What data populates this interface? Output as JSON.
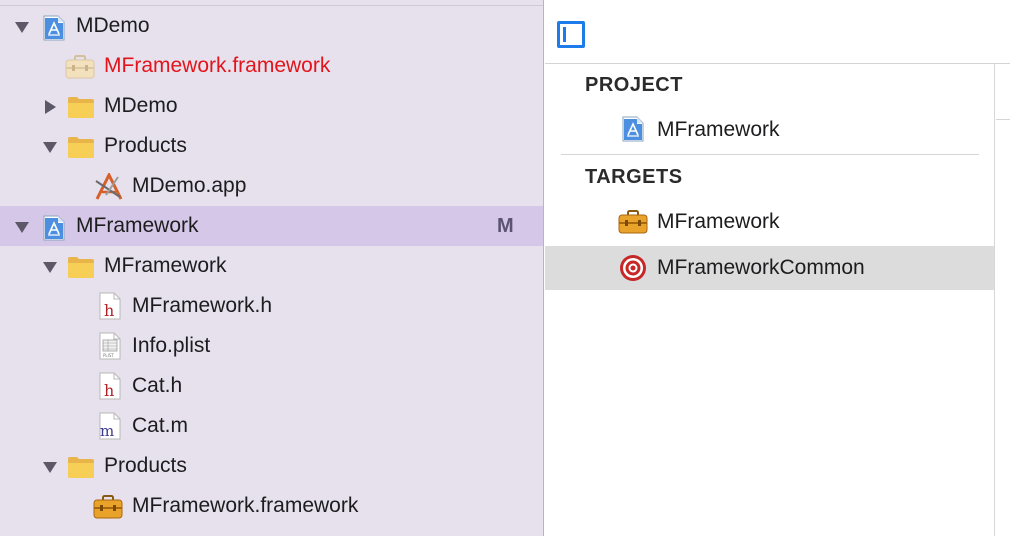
{
  "navigator": {
    "items": [
      {
        "label": "MDemo",
        "disclosure": "expanded",
        "icon": "xcode-project-icon"
      },
      {
        "label": "MFramework.framework",
        "disclosure": "none",
        "icon": "framework-missing-icon",
        "color": "#e3141b"
      },
      {
        "label": "MDemo",
        "disclosure": "collapsed",
        "icon": "folder-icon"
      },
      {
        "label": "Products",
        "disclosure": "expanded",
        "icon": "folder-icon"
      },
      {
        "label": "MDemo.app",
        "disclosure": "none",
        "icon": "app-icon"
      },
      {
        "label": "MFramework",
        "disclosure": "expanded",
        "icon": "xcode-project-icon",
        "badge": "M",
        "selected": true
      },
      {
        "label": "MFramework",
        "disclosure": "expanded",
        "icon": "folder-icon"
      },
      {
        "label": "MFramework.h",
        "disclosure": "none",
        "icon": "header-file-icon"
      },
      {
        "label": "Info.plist",
        "disclosure": "none",
        "icon": "plist-file-icon"
      },
      {
        "label": "Cat.h",
        "disclosure": "none",
        "icon": "header-file-icon"
      },
      {
        "label": "Cat.m",
        "disclosure": "none",
        "icon": "objc-file-icon"
      },
      {
        "label": "Products",
        "disclosure": "expanded",
        "icon": "folder-icon"
      },
      {
        "label": "MFramework.framework",
        "disclosure": "none",
        "icon": "framework-icon"
      }
    ]
  },
  "editor": {
    "sidebar_toggle_icon": "sidebar-toggle-icon",
    "project_header": "PROJECT",
    "project_item": "MFramework",
    "targets_header": "TARGETS",
    "targets": [
      {
        "label": "MFramework",
        "icon": "framework-target-icon"
      },
      {
        "label": "MFrameworkCommon",
        "icon": "target-bullseye-icon",
        "selected": true
      }
    ]
  },
  "colors": {
    "navigator_bg": "#e6e1ec",
    "navigator_selected": "#d5c7e7",
    "missing_file_red": "#e3141b",
    "accent_blue": "#1d7bea",
    "target_selected": "#dcdcdc"
  }
}
